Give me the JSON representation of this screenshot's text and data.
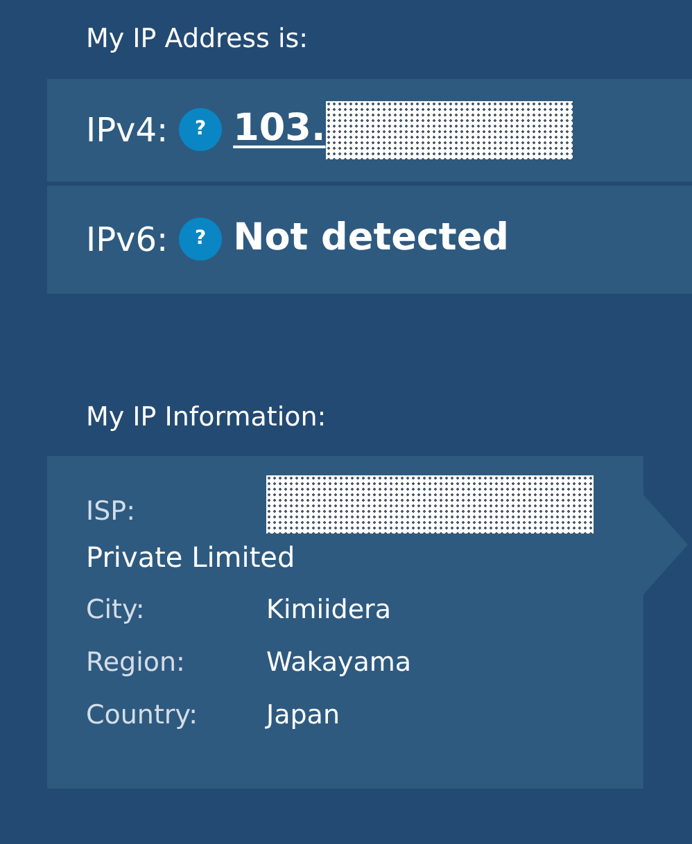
{
  "address_heading": "My IP Address is:",
  "addresses": [
    {
      "label": "IPv4:",
      "help": "?",
      "value": "103.",
      "link": true,
      "redacted": true
    },
    {
      "label": "IPv6:",
      "help": "?",
      "value": "Not detected",
      "link": false,
      "redacted": false
    }
  ],
  "info_heading": "My IP Information:",
  "isp": {
    "label": "ISP:",
    "redacted": true,
    "value": "Private Limited"
  },
  "details": [
    {
      "label": "City:",
      "value": "Kimiidera"
    },
    {
      "label": "Region:",
      "value": "Wakayama"
    },
    {
      "label": "Country:",
      "value": "Japan"
    }
  ]
}
